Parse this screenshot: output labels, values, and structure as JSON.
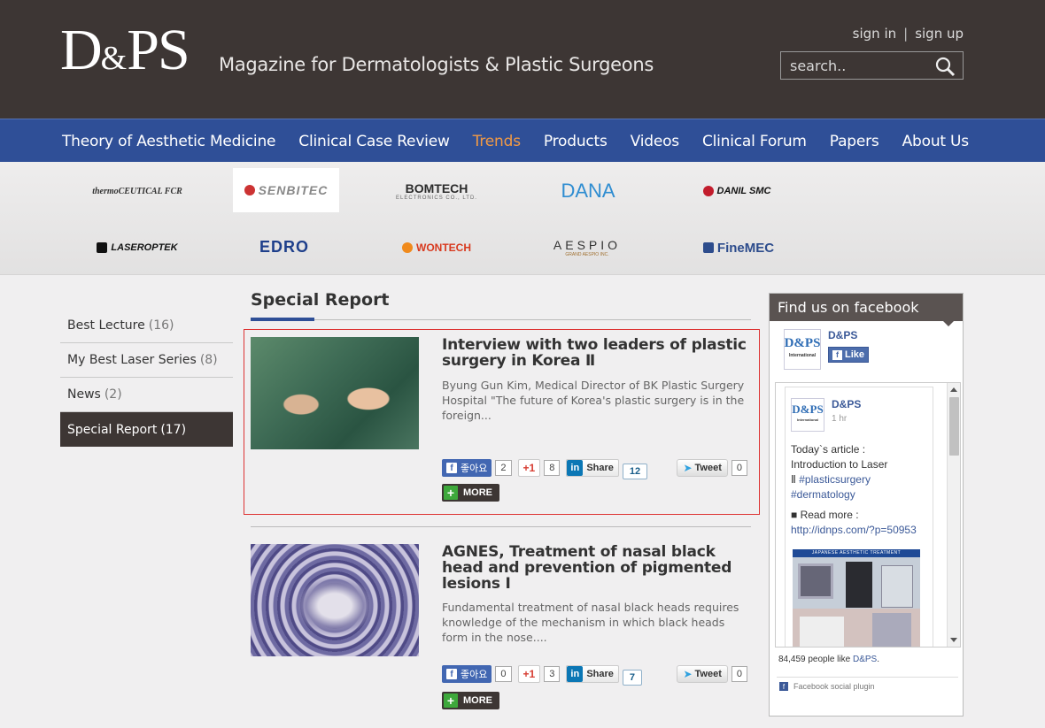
{
  "header": {
    "logo_main": "D",
    "logo_amp": "&",
    "logo_tail": "PS",
    "tagline": "Magazine for Dermatologists & Plastic Surgeons",
    "sign_in": "sign in",
    "sign_sep": "|",
    "sign_up": "sign up",
    "search_placeholder": "search.."
  },
  "nav": {
    "items": [
      "Theory of Aesthetic Medicine",
      "Clinical Case Review",
      "Trends",
      "Products",
      "Videos",
      "Clinical Forum",
      "Papers",
      "About Us"
    ],
    "active": "Trends"
  },
  "sponsors": {
    "s1": "thermoCEUTICAL FCR",
    "s2": "SENBITEC",
    "s3": "BOMTECH",
    "s3_sub": "ELECTRONICS CO., LTD.",
    "s4": "DANA",
    "s5": "DANIL SMC",
    "s6": "LASEROPTEK",
    "s7": "EDRO",
    "s8": "WONTECH",
    "s9": "AESPIO",
    "s9_sub": "GRAND AESPIO INC.",
    "s10": "FineMEC"
  },
  "sidebar": {
    "items": [
      {
        "label": "Best Lecture",
        "count": "(16)"
      },
      {
        "label": "My Best Laser Series",
        "count": "(8)"
      },
      {
        "label": "News",
        "count": "(2)"
      },
      {
        "label": "Special Report",
        "count": "(17)"
      }
    ]
  },
  "main": {
    "section_title": "Special Report",
    "articles": [
      {
        "title": "Interview with two leaders of plastic surgery in Korea Ⅱ",
        "desc": "Byung Gun Kim, Medical Director of BK Plastic Surgery Hospital \"The future of Korea's plastic surgery is in the foreign...",
        "fb_label": "좋아요",
        "fb_count": "2",
        "g_label": "+1",
        "g_count": "8",
        "in_label": "Share",
        "in_count": "12",
        "tw_label": "Tweet",
        "tw_count": "0",
        "more": "MORE"
      },
      {
        "title": "AGNES, Treatment of nasal black head and prevention of pigmented lesions Ⅰ",
        "desc": "Fundamental treatment of nasal black heads requires knowledge of the mechanism in which black heads form in the nose....",
        "fb_label": "좋아요",
        "fb_count": "0",
        "g_label": "+1",
        "g_count": "3",
        "in_label": "Share",
        "in_count": "7",
        "tw_label": "Tweet",
        "tw_count": "0",
        "more": "MORE"
      }
    ]
  },
  "facebook": {
    "heading": "Find us on facebook",
    "page_name": "D&PS",
    "logo_text": "D&PS",
    "logo_sub": "International",
    "like_label": "Like",
    "post": {
      "name": "D&PS",
      "time": "1 hr",
      "line1": "Today`s article :",
      "line2": "Introduction to Laser",
      "line3_prefix": "Ⅱ ",
      "tag1": "#plasticsurgery",
      "tag2": "#dermatology",
      "readmore": "■ Read more :",
      "url": "http://idnps.com/?p=50953",
      "image_caption": "JAPANESE AESTHETIC TREATMENT"
    },
    "likes_text": "84,459 people like",
    "likes_page": "D&PS",
    "likes_dot": ".",
    "plugin_label": "Facebook social plugin"
  },
  "colors": {
    "header_bg": "#3d3634",
    "nav_bg": "#2f4f97",
    "nav_active": "#f39a44",
    "highlight_border": "#dd3333"
  }
}
